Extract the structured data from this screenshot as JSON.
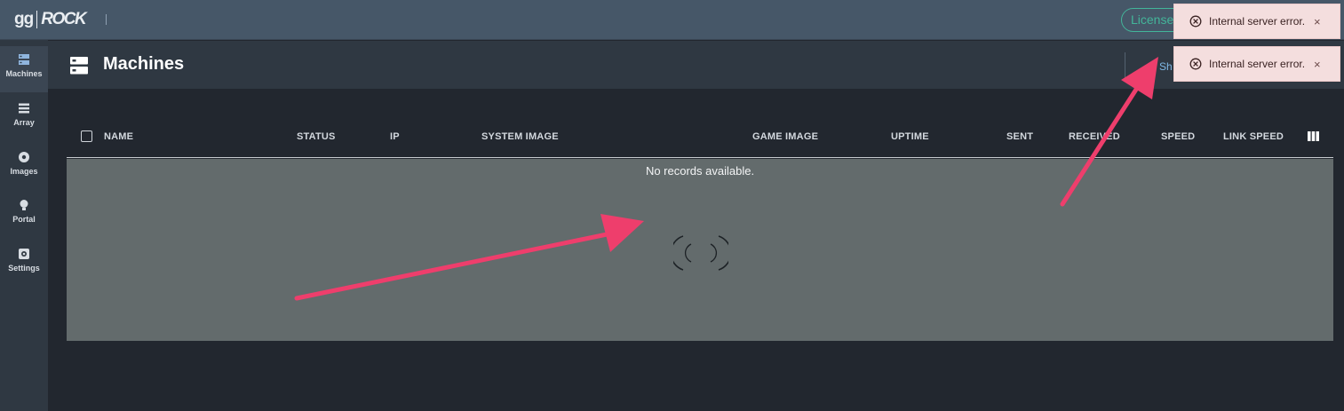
{
  "topbar": {
    "logo_gg": "gg",
    "logo_rock": "ROCK",
    "license_label": "License"
  },
  "sidebar": {
    "items": [
      {
        "label": "Machines",
        "icon": "server-icon",
        "active": true
      },
      {
        "label": "Array",
        "icon": "list-icon",
        "active": false
      },
      {
        "label": "Images",
        "icon": "disc-icon",
        "active": false
      },
      {
        "label": "Portal",
        "icon": "bulb-icon",
        "active": false
      },
      {
        "label": "Settings",
        "icon": "gear-icon",
        "active": false
      }
    ]
  },
  "page": {
    "title": "Machines",
    "show_label": "Sh"
  },
  "table": {
    "columns": [
      "NAME",
      "STATUS",
      "IP",
      "SYSTEM IMAGE",
      "GAME IMAGE",
      "UPTIME",
      "SENT",
      "RECEIVED",
      "SPEED",
      "LINK SPEED"
    ],
    "empty_text": "No records available."
  },
  "toasts": [
    {
      "message": "Internal server error.",
      "close": "×"
    },
    {
      "message": "Internal server error.",
      "close": "×"
    }
  ],
  "colors": {
    "accent_teal": "#43b59a",
    "toast_bg": "#f4dede",
    "annotation_arrow": "#ee3e6c"
  }
}
